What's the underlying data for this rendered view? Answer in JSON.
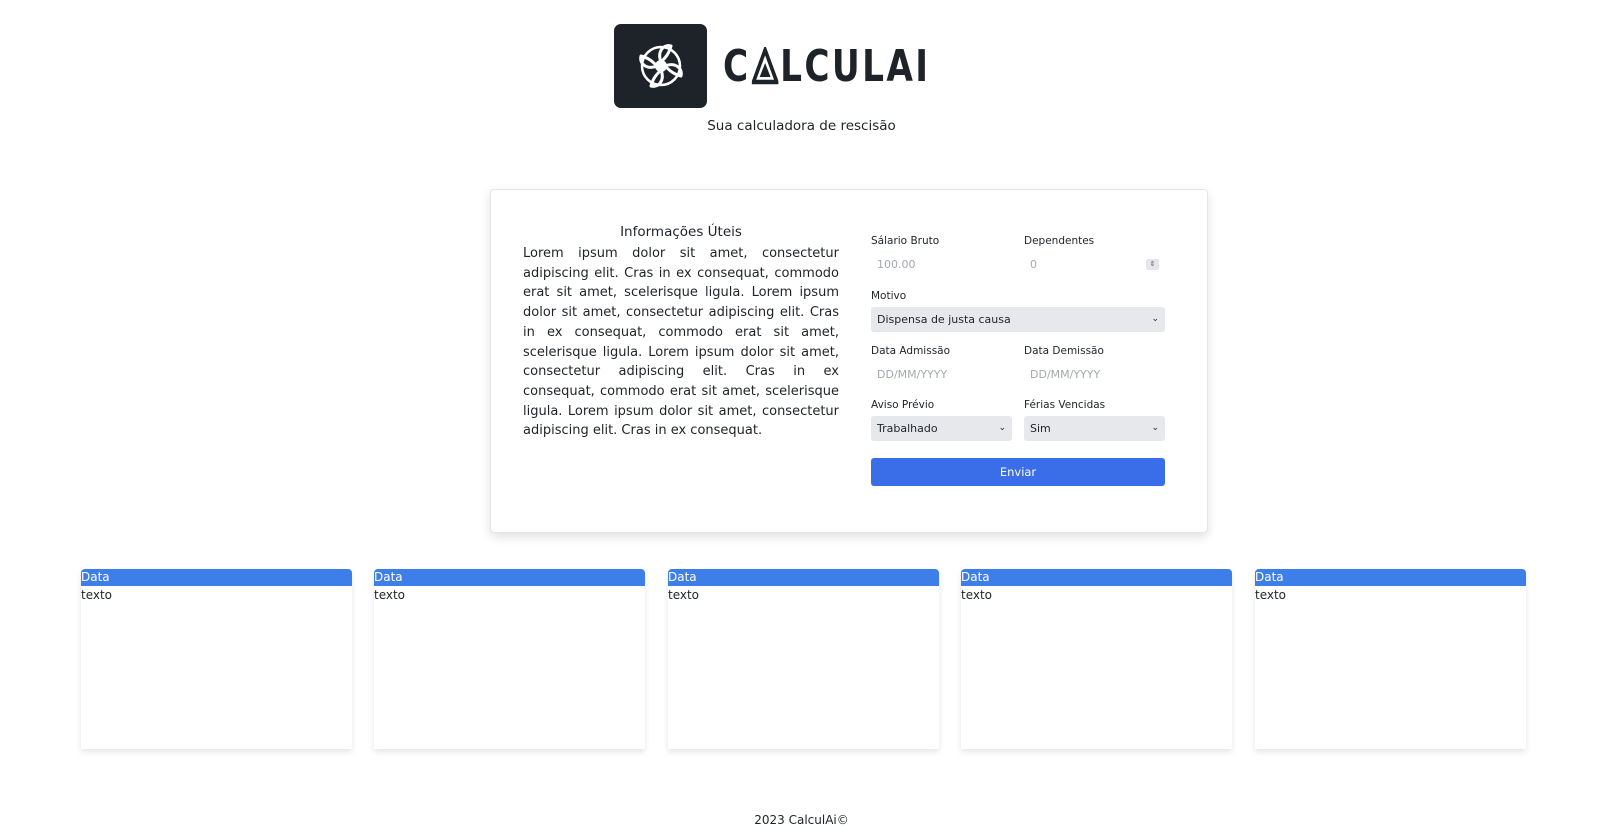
{
  "brand": {
    "logo_icon": "aperture-flower-icon",
    "name_pre": "C",
    "name_post": "LCULAI",
    "tagline": "Sua calculadora de rescisão"
  },
  "info": {
    "title": "Informações Úteis",
    "text": "Lorem ipsum dolor sit amet, consectetur adipiscing elit. Cras in ex consequat, commodo erat sit amet, scelerisque ligula. Lorem ipsum dolor sit amet, consectetur adipiscing elit. Cras in ex consequat, commodo erat sit amet, scelerisque ligula. Lorem ipsum dolor sit amet, consectetur adipiscing elit. Cras in ex consequat, commodo erat sit amet, scelerisque ligula. Lorem ipsum dolor sit amet, consectetur adipiscing elit. Cras in ex consequat."
  },
  "form": {
    "salario_label": "Sálario Bruto",
    "salario_placeholder": "100.00",
    "dependentes_label": "Dependentes",
    "dependentes_placeholder": "0",
    "motivo_label": "Motivo",
    "motivo_value": "Dispensa de justa causa",
    "admissao_label": "Data Admissão",
    "admissao_placeholder": "DD/MM/YYYY",
    "demissao_label": "Data Demissão",
    "demissao_placeholder": "DD/MM/YYYY",
    "aviso_label": "Aviso Prévio",
    "aviso_value": "Trabalhado",
    "ferias_label": "Férias Vencidas",
    "ferias_value": "Sim",
    "submit_label": "Enviar"
  },
  "data_cards": [
    {
      "header": "Data",
      "body": "texto"
    },
    {
      "header": "Data",
      "body": "texto"
    },
    {
      "header": "Data",
      "body": "texto"
    },
    {
      "header": "Data",
      "body": "texto"
    },
    {
      "header": "Data",
      "body": "texto"
    }
  ],
  "footer": {
    "text": "2023 CalculAi©"
  },
  "colors": {
    "primary_button": "#3a6ee8",
    "card_header": "#3d7ee8",
    "logo_bg": "#1e232a"
  }
}
